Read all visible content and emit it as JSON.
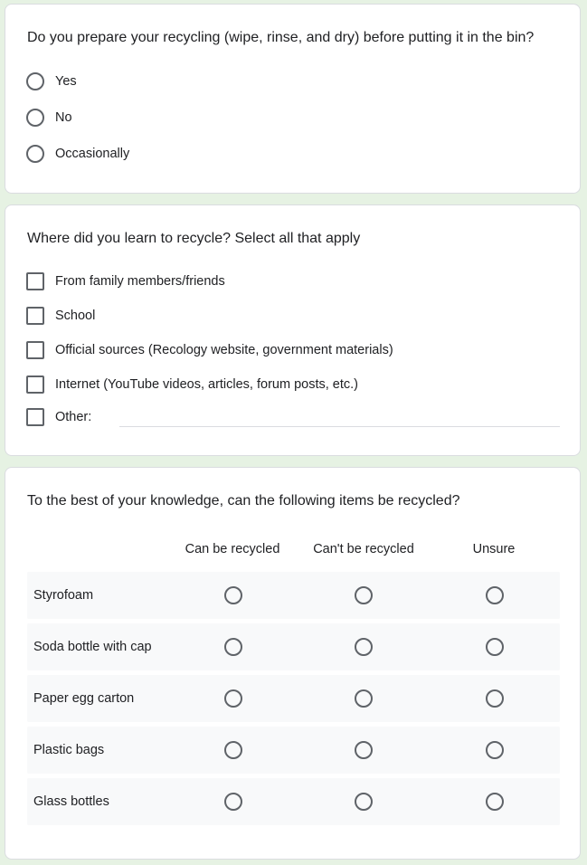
{
  "q1": {
    "title": "Do you prepare your recycling (wipe, rinse, and dry) before putting it in the bin?",
    "options": [
      "Yes",
      "No",
      "Occasionally"
    ]
  },
  "q2": {
    "title": "Where did you learn to recycle? Select all that apply",
    "options": [
      "From family members/friends",
      "School",
      "Official sources (Recology website, government materials)",
      "Internet (YouTube videos, articles, forum posts, etc.)"
    ],
    "other_label": "Other:"
  },
  "q3": {
    "title": "To the best of your knowledge, can the following items be recycled?",
    "columns": [
      "Can be recycled",
      "Can't be recycled",
      "Unsure"
    ],
    "rows": [
      "Styrofoam",
      "Soda bottle with cap",
      "Paper egg carton",
      "Plastic bags",
      "Glass bottles"
    ]
  }
}
